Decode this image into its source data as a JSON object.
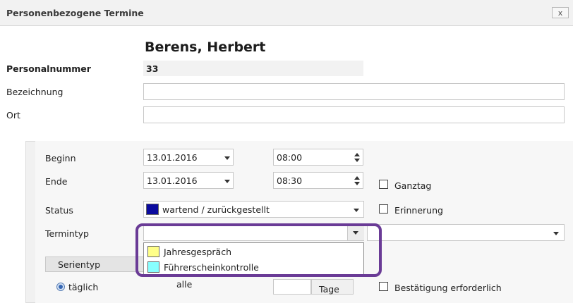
{
  "window": {
    "title": "Personenbezogene Termine",
    "close_label": "x"
  },
  "person": {
    "name": "Berens, Herbert"
  },
  "fields": {
    "personalnummer_label": "Personalnummer",
    "personalnummer_value": "33",
    "bezeichnung_label": "Bezeichnung",
    "bezeichnung_value": "",
    "ort_label": "Ort",
    "ort_value": ""
  },
  "schedule": {
    "beginn_label": "Beginn",
    "beginn_date": "13.01.2016",
    "beginn_time": "08:00",
    "ende_label": "Ende",
    "ende_date": "13.01.2016",
    "ende_time": "08:30",
    "ganztag_label": "Ganztag",
    "ganztag_checked": false,
    "status_label": "Status",
    "status_value": "wartend / zurückgestellt",
    "status_color": "#0a0a9e",
    "erinnerung_label": "Erinnerung",
    "erinnerung_checked": false,
    "termintyp_label": "Termintyp",
    "termintyp_value": "",
    "termintyp_options": [
      {
        "label": "Jahresgespräch",
        "color": "#ffff88"
      },
      {
        "label": "Führerscheinkontrolle",
        "color": "#88ffff"
      }
    ],
    "serientyp_label": "Serientyp",
    "recurrence_option": "täglich",
    "alle_label": "alle",
    "tage_label": "Tage",
    "bestaetigung_label": "Bestätigung erforderlich"
  },
  "colors": {
    "highlight": "#6a3b96"
  }
}
